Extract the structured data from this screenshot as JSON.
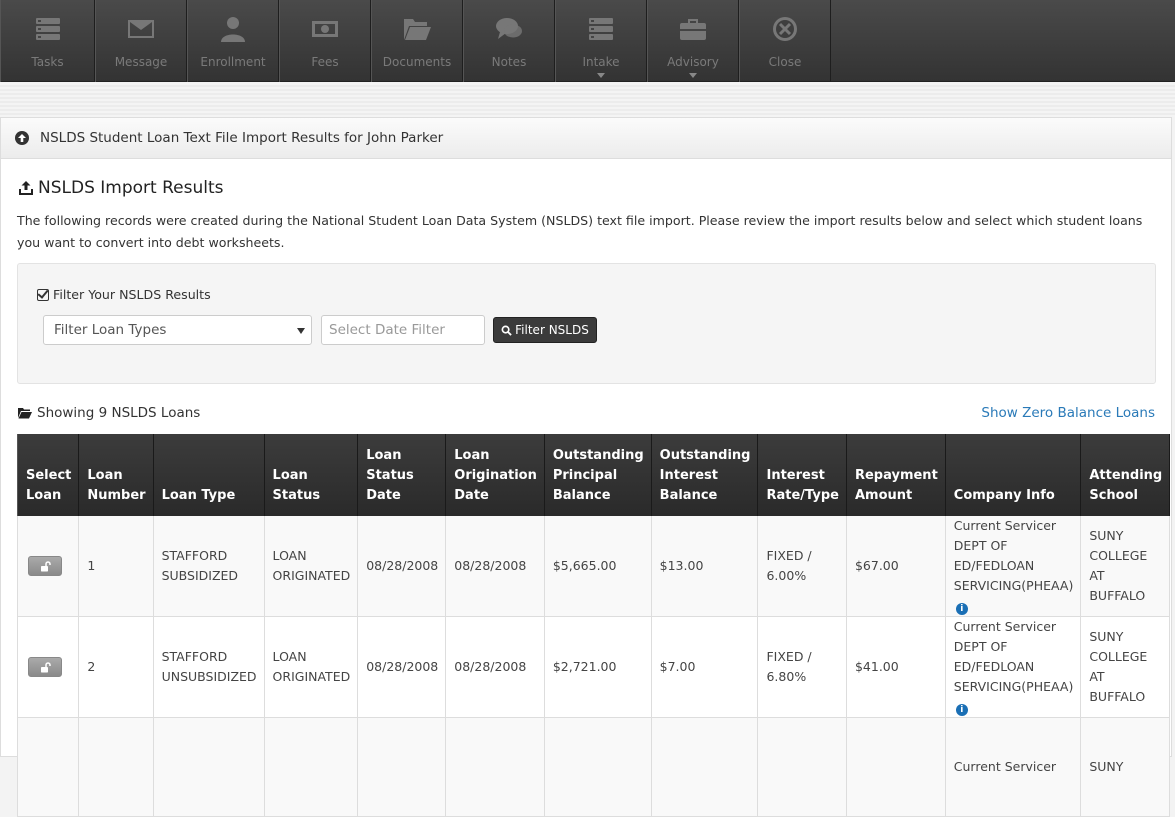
{
  "toolbar": {
    "items": [
      {
        "label": "Tasks",
        "icon": "tasks-icon"
      },
      {
        "label": "Message",
        "icon": "envelope-icon"
      },
      {
        "label": "Enrollment",
        "icon": "user-icon"
      },
      {
        "label": "Fees",
        "icon": "money-icon"
      },
      {
        "label": "Documents",
        "icon": "folder-icon"
      },
      {
        "label": "Notes",
        "icon": "comments-icon"
      },
      {
        "label": "Intake",
        "icon": "tasks-icon"
      },
      {
        "label": "Advisory",
        "icon": "briefcase-icon"
      },
      {
        "label": "Close",
        "icon": "close-icon"
      }
    ]
  },
  "panel": {
    "title": "NSLDS Student Loan Text File Import Results for John Parker"
  },
  "section": {
    "heading": "NSLDS Import Results",
    "description": "The following records were created during the National Student Loan Data System (NSLDS) text file import. Please review the import results below and select which student loans you want to convert into debt worksheets."
  },
  "filter": {
    "label": "Filter Your NSLDS Results",
    "loan_types_value": "Filter Loan Types",
    "date_placeholder": "Select Date Filter",
    "button_label": "Filter NSLDS"
  },
  "results": {
    "showing": "Showing 9 NSLDS Loans",
    "zero_balance_link": "Show Zero Balance Loans"
  },
  "table": {
    "headers": [
      "Select Loan",
      "Loan Number",
      "Loan Type",
      "Loan Status",
      "Loan Status Date",
      "Loan Origination Date",
      "Outstanding Principal Balance",
      "Outstanding Interest Balance",
      "Interest Rate/Type",
      "Repayment Amount",
      "Company Info",
      "Attending School"
    ],
    "rows": [
      {
        "number": "1",
        "type": "STAFFORD SUBSIDIZED",
        "status": "LOAN ORIGINATED",
        "status_date": "08/28/2008",
        "origination_date": "08/28/2008",
        "principal": "$5,665.00",
        "interest": "$13.00",
        "rate": "FIXED / 6.00%",
        "repayment": "$67.00",
        "company": "Current Servicer DEPT OF ED/FEDLOAN SERVICING(PHEAA)",
        "school": "SUNY COLLEGE AT BUFFALO"
      },
      {
        "number": "2",
        "type": "STAFFORD UNSUBSIDIZED",
        "status": "LOAN ORIGINATED",
        "status_date": "08/28/2008",
        "origination_date": "08/28/2008",
        "principal": "$2,721.00",
        "interest": "$7.00",
        "rate": "FIXED / 6.80%",
        "repayment": "$41.00",
        "company": "Current Servicer DEPT OF ED/FEDLOAN SERVICING(PHEAA)",
        "school": "SUNY COLLEGE AT BUFFALO"
      },
      {
        "number": "",
        "type": "",
        "status": "",
        "status_date": "",
        "origination_date": "",
        "principal": "",
        "interest": "",
        "rate": "",
        "repayment": "",
        "company": "Current Servicer",
        "school": "SUNY"
      }
    ]
  },
  "colors": {
    "toolbar_bg": "#3a3a3a",
    "link": "#2a7ab8",
    "info": "#1a6fb5",
    "table_header": "#333333"
  }
}
